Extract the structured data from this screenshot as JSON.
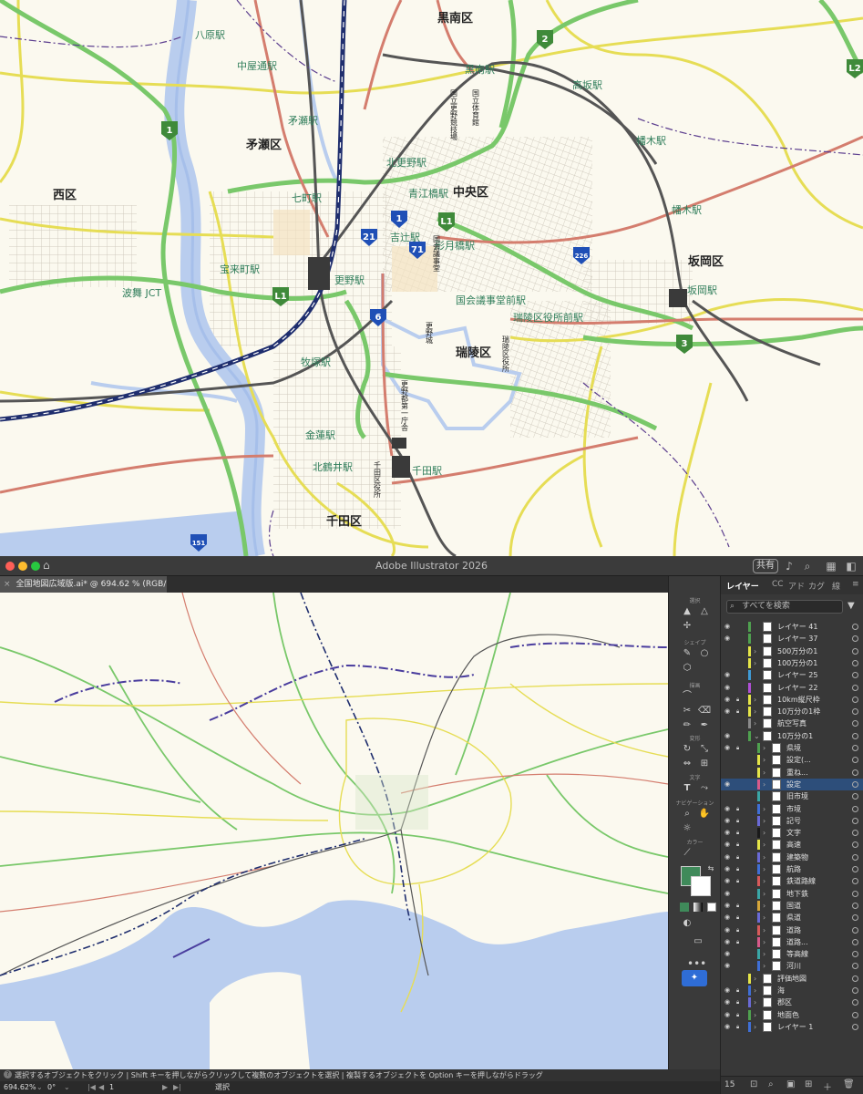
{
  "map": {
    "districts": [
      "黒南区",
      "矛瀬区",
      "西区",
      "中央区",
      "坂岡区",
      "瑞陵区",
      "千田区"
    ],
    "stations": [
      "八原駅",
      "中屋通駅",
      "矛瀬駅",
      "黒南駅",
      "高坂駅",
      "幡木駅",
      "幡木駅",
      "北更野駅",
      "七町駅",
      "青江橋駅",
      "吉辻駅",
      "形月橋駅",
      "宝来町駅",
      "更野駅",
      "波舞 JCT",
      "国会議事堂前駅",
      "瑞陵区役所前駅",
      "坂岡駅",
      "牧塚駅",
      "金蓮駅",
      "北鶴井駅",
      "千田駅"
    ],
    "facilities": [
      "国立更野競技場",
      "国立体育館",
      "国会議事堂",
      "更野城",
      "更野都第一庁舎",
      "瑞陵区役所",
      "千田区役所"
    ],
    "route_badges": [
      "1",
      "2",
      "L2",
      "1",
      "21",
      "71",
      "L1",
      "226",
      "L1",
      "6",
      "3",
      "151"
    ]
  },
  "app": {
    "title": "Adobe Illustrator 2026",
    "share_label": "共有",
    "doc_tab": "全国地図広域版.ai* @ 694.62 % (RGB/プレビュー)",
    "tools": {
      "select_label": "選択",
      "shape_label": "シェイプ",
      "draw_label": "描画",
      "transform_label": "変形",
      "type_label": "文字",
      "nav_label": "ナビゲーション",
      "color_label": "カラー",
      "fill_color": "#3f8a5a"
    },
    "panel": {
      "tabs": [
        "CC",
        "アド",
        "カグ",
        "線"
      ],
      "active_tab": "レイヤー",
      "search_placeholder": "すべてを検索",
      "count": "15",
      "layers": [
        {
          "name": "レイヤー 41",
          "color": "#4fa14f",
          "eye": true,
          "lock": false,
          "indent": 0,
          "chev": false
        },
        {
          "name": "レイヤー 37",
          "color": "#4fa14f",
          "eye": true,
          "lock": false,
          "indent": 0,
          "chev": false
        },
        {
          "name": "500万分の1",
          "color": "#e5e548",
          "eye": false,
          "lock": false,
          "indent": 0,
          "chev": true
        },
        {
          "name": "100万分の1",
          "color": "#e5e548",
          "eye": false,
          "lock": false,
          "indent": 0,
          "chev": true
        },
        {
          "name": "レイヤー 25",
          "color": "#3f9bd6",
          "eye": true,
          "lock": false,
          "indent": 0,
          "chev": false
        },
        {
          "name": "レイヤー 22",
          "color": "#b04fd6",
          "eye": true,
          "lock": false,
          "indent": 0,
          "chev": false
        },
        {
          "name": "10km縦尺枠",
          "color": "#e5e548",
          "eye": true,
          "lock": true,
          "indent": 0,
          "chev": true
        },
        {
          "name": "10万分の1枠",
          "color": "#e5e548",
          "eye": true,
          "lock": true,
          "indent": 0,
          "chev": true
        },
        {
          "name": "航空写真",
          "color": "#8a8a8a",
          "eye": false,
          "lock": false,
          "indent": 0,
          "chev": true
        },
        {
          "name": "10万分の1",
          "color": "#4fa14f",
          "eye": true,
          "lock": false,
          "indent": 0,
          "chev": true,
          "open": true
        },
        {
          "name": "県境",
          "color": "#4fa14f",
          "eye": true,
          "lock": true,
          "indent": 1,
          "chev": true
        },
        {
          "name": "設定(...",
          "color": "#e5e548",
          "eye": false,
          "lock": false,
          "indent": 1,
          "chev": true
        },
        {
          "name": "重ね...",
          "color": "#e5e548",
          "eye": false,
          "lock": false,
          "indent": 1,
          "chev": true
        },
        {
          "name": "設定",
          "color": "#d65a8a",
          "eye": true,
          "lock": false,
          "indent": 1,
          "chev": true,
          "selected": true
        },
        {
          "name": "旧市境",
          "color": "#3aa6a6",
          "eye": false,
          "lock": false,
          "indent": 1,
          "chev": false
        },
        {
          "name": "市境",
          "color": "#3f6fd6",
          "eye": true,
          "lock": true,
          "indent": 1,
          "chev": true
        },
        {
          "name": "記号",
          "color": "#6a6ad6",
          "eye": true,
          "lock": true,
          "indent": 1,
          "chev": true
        },
        {
          "name": "文字",
          "color": "#1a1a1a",
          "eye": true,
          "lock": true,
          "indent": 1,
          "chev": true
        },
        {
          "name": "高速",
          "color": "#e5e548",
          "eye": true,
          "lock": true,
          "indent": 1,
          "chev": true
        },
        {
          "name": "建築物",
          "color": "#6a6ad6",
          "eye": true,
          "lock": true,
          "indent": 1,
          "chev": true
        },
        {
          "name": "航路",
          "color": "#3f6fd6",
          "eye": true,
          "lock": true,
          "indent": 1,
          "chev": true
        },
        {
          "name": "鉄道路線",
          "color": "#d65a5a",
          "eye": true,
          "lock": true,
          "indent": 1,
          "chev": true
        },
        {
          "name": "地下鉄",
          "color": "#3aa6a6",
          "eye": true,
          "lock": false,
          "indent": 1,
          "chev": true
        },
        {
          "name": "国道",
          "color": "#d6a63a",
          "eye": true,
          "lock": true,
          "indent": 1,
          "chev": true
        },
        {
          "name": "県道",
          "color": "#6a6ad6",
          "eye": true,
          "lock": true,
          "indent": 1,
          "chev": true
        },
        {
          "name": "道路",
          "color": "#d65a5a",
          "eye": true,
          "lock": true,
          "indent": 1,
          "chev": true
        },
        {
          "name": "道路...",
          "color": "#d65a8a",
          "eye": true,
          "lock": true,
          "indent": 1,
          "chev": true
        },
        {
          "name": "等高線",
          "color": "#3aa6a6",
          "eye": true,
          "lock": false,
          "indent": 1,
          "chev": true
        },
        {
          "name": "河川",
          "color": "#3f6fd6",
          "eye": true,
          "lock": false,
          "indent": 1,
          "chev": true
        },
        {
          "name": "評価地図",
          "color": "#e5e548",
          "eye": false,
          "lock": false,
          "indent": 0,
          "chev": true
        },
        {
          "name": "海",
          "color": "#3f6fd6",
          "eye": true,
          "lock": true,
          "indent": 0,
          "chev": true
        },
        {
          "name": "郡区",
          "color": "#6a6ad6",
          "eye": true,
          "lock": true,
          "indent": 0,
          "chev": true
        },
        {
          "name": "地面色",
          "color": "#4fa14f",
          "eye": true,
          "lock": true,
          "indent": 0,
          "chev": true
        },
        {
          "name": "レイヤー 1",
          "color": "#3f6fd6",
          "eye": true,
          "lock": true,
          "indent": 0,
          "chev": true
        }
      ]
    },
    "hint": "選択するオブジェクトをクリック | Shift キーを押しながらクリックして複数のオブジェクトを選択 | 複製するオブジェクトを Option キーを押しながらドラッグ",
    "status": {
      "zoom": "694.62%",
      "angle": "0°",
      "artboard": "1",
      "tool": "選択"
    }
  }
}
